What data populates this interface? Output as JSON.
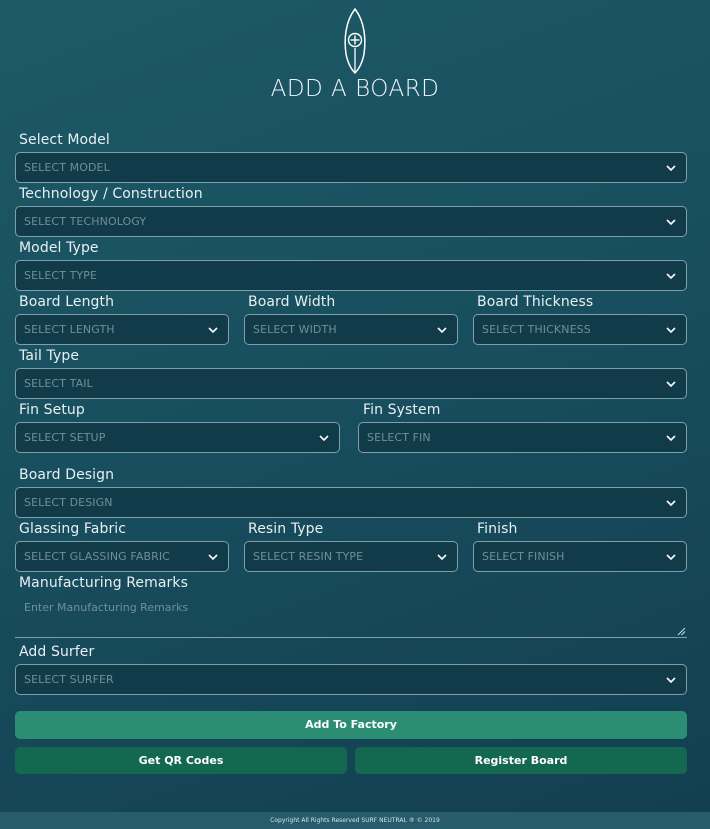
{
  "header": {
    "logo_icon": "surfboard-add-icon",
    "title": "ADD A BOARD"
  },
  "form": {
    "model": {
      "label": "Select Model",
      "placeholder": "SELECT MODEL"
    },
    "technology": {
      "label": "Technology / Construction",
      "placeholder": "SELECT TECHNOLOGY"
    },
    "model_type": {
      "label": "Model Type",
      "placeholder": "SELECT TYPE"
    },
    "length": {
      "label": "Board Length",
      "placeholder": "SELECT LENGTH"
    },
    "width": {
      "label": "Board Width",
      "placeholder": "SELECT WIDTH"
    },
    "thickness": {
      "label": "Board Thickness",
      "placeholder": "SELECT THICKNESS"
    },
    "tail": {
      "label": "Tail Type",
      "placeholder": "SELECT TAIL"
    },
    "fin_setup": {
      "label": "Fin Setup",
      "placeholder": "SELECT SETUP"
    },
    "fin_system": {
      "label": "Fin System",
      "placeholder": "SELECT FIN"
    },
    "design": {
      "label": "Board Design",
      "placeholder": "SELECT DESIGN"
    },
    "glassing": {
      "label": "Glassing Fabric",
      "placeholder": "SELECT GLASSING FABRIC"
    },
    "resin": {
      "label": "Resin Type",
      "placeholder": "SELECT RESIN TYPE"
    },
    "finish": {
      "label": "Finish",
      "placeholder": "SELECT FINISH"
    },
    "remarks": {
      "label": "Manufacturing Remarks",
      "placeholder": "Enter Manufacturing Remarks"
    },
    "surfer": {
      "label": "Add Surfer",
      "placeholder": "SELECT SURFER"
    }
  },
  "actions": {
    "add_to_factory": "Add To Factory",
    "get_qr_codes": "Get QR Codes",
    "register_board": "Register Board"
  },
  "footer": {
    "copyright": "Copyright All Rights Reserved SURF NEUTRAL ® © 2019"
  },
  "colors": {
    "background": "#184f5e",
    "field_bg": "#123b49",
    "field_border": "#7ea0aa",
    "primary_button": "#2b8d74",
    "secondary_button": "#14684f"
  }
}
